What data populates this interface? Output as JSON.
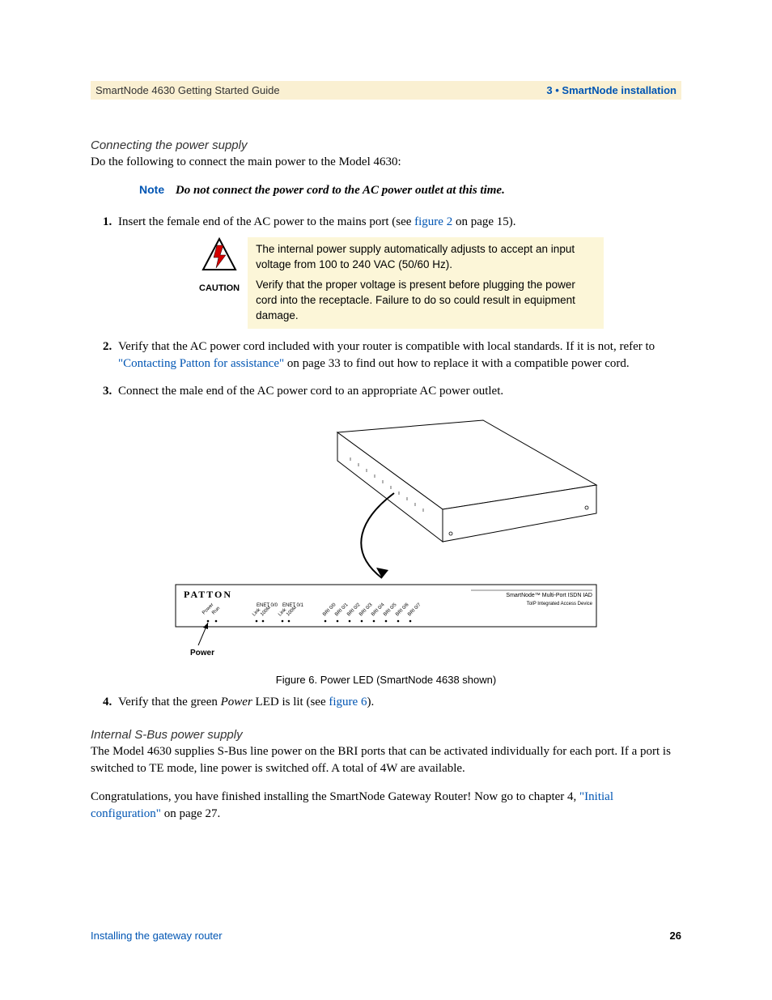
{
  "header": {
    "left": "SmartNode 4630 Getting Started Guide",
    "right": "3 • SmartNode installation"
  },
  "section1": {
    "title": "Connecting the power supply",
    "intro": "Do the following to connect the main power to the Model 4630:"
  },
  "note": {
    "label": "Note",
    "text": "Do not connect the power cord to the AC power outlet at this time."
  },
  "step1": {
    "pre": "Insert the female end of the AC power to the mains port (see ",
    "link": "figure 2",
    "post": " on page 15)."
  },
  "caution": {
    "label": "CAUTION",
    "p1": "The internal power supply automatically adjusts to accept an input voltage from 100 to 240 VAC (50/60 Hz).",
    "p2": "Verify that the proper voltage is present before plugging the power cord into the receptacle. Failure to do so could result in equipment damage."
  },
  "step2": {
    "pre": "Verify that the AC power cord included with your router is compatible with local standards. If it is not, refer to ",
    "link": "\"Contacting Patton for assistance\"",
    "post": " on page 33 to find out how to replace it with a compatible power cord."
  },
  "step3": "Connect the male end of the AC power cord to an appropriate AC power outlet.",
  "figure": {
    "brand": "PATTON",
    "line1": "SmartNode™ Multi-Port ISDN IAD",
    "line2": "ToIP Integrated Access Device",
    "enet0": "ENET 0/0",
    "enet1": "ENET 0/1",
    "power_label": "Power",
    "caption": "Figure 6. Power LED (SmartNode 4638 shown)"
  },
  "step4": {
    "pre": "Verify that the green ",
    "em": "Power",
    "mid": " LED is lit (see ",
    "link": "figure 6",
    "post": ")."
  },
  "section2": {
    "title": "Internal S-Bus power supply",
    "p1": "The Model 4630 supplies S-Bus line power on the BRI ports that can be activated individually for each port. If a port is switched to TE mode, line power is switched off. A total of 4W are available.",
    "p2_pre": "Congratulations, you have finished installing the SmartNode Gateway Router! Now go to chapter 4, ",
    "p2_link": "\"Initial configuration\"",
    "p2_post": " on page 27."
  },
  "footer": {
    "left": "Installing the gateway router",
    "right": "26"
  }
}
